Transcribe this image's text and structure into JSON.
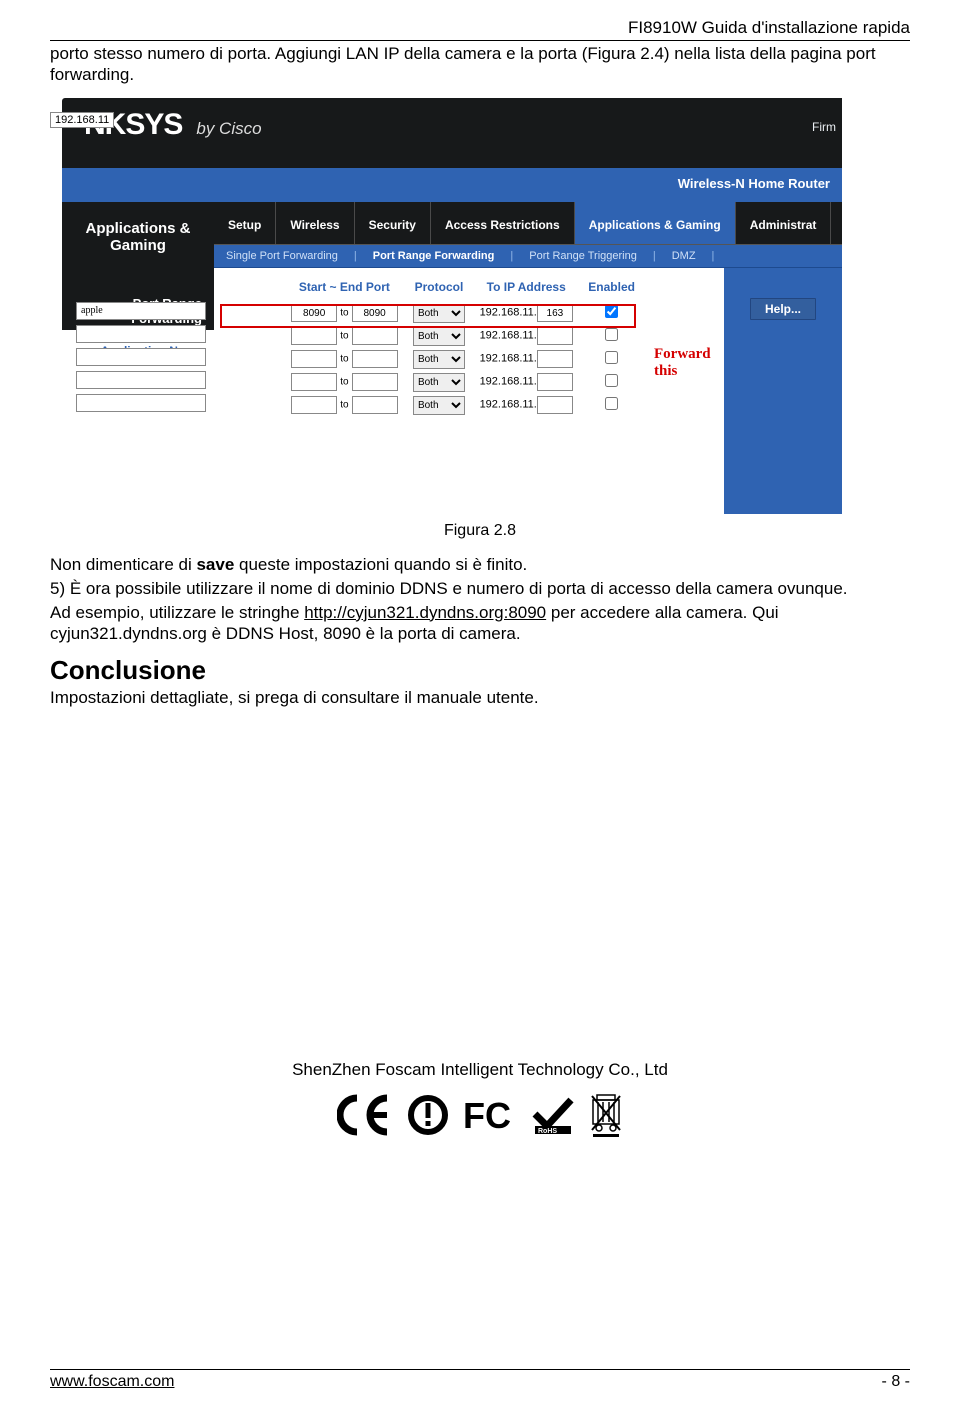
{
  "header_title": "FI8910W Guida d'installazione rapida",
  "intro": "porto stesso numero di porta. Aggiungi LAN IP della camera e la porta (Figura 2.4) nella lista della pagina port forwarding.",
  "router": {
    "ip_hint": "192.168.11",
    "brand_logo": "NKSYS",
    "brand_by": "by Cisco",
    "fir_label": "Firm",
    "bluebar_right": "",
    "bluebar_model": "Wireless-N Home Router",
    "side_section": "Applications & Gaming",
    "side_subsection": "Port Range Forwarding",
    "side_applabel": "Application Name",
    "tabs": [
      "Setup",
      "Wireless",
      "Security",
      "Access Restrictions",
      "Applications & Gaming",
      "Administrat"
    ],
    "active_tab": 4,
    "subtabs": [
      "Single Port Forwarding",
      "Port Range Forwarding",
      "Port Range Triggering",
      "DMZ"
    ],
    "active_subtab": 1,
    "help_label": "Help...",
    "table": {
      "headers": [
        "Start ~ End Port",
        "Protocol",
        "To IP Address",
        "Enabled"
      ],
      "rows": [
        {
          "app": "apple",
          "start": "8090",
          "end": "8090",
          "protocol": "Both",
          "ip_prefix": "192.168.11.",
          "ip_suffix": "163",
          "enabled": true
        },
        {
          "app": "",
          "start": "",
          "end": "",
          "protocol": "Both",
          "ip_prefix": "192.168.11.",
          "ip_suffix": "",
          "enabled": false
        },
        {
          "app": "",
          "start": "",
          "end": "",
          "protocol": "Both",
          "ip_prefix": "192.168.11.",
          "ip_suffix": "",
          "enabled": false
        },
        {
          "app": "",
          "start": "",
          "end": "",
          "protocol": "Both",
          "ip_prefix": "192.168.11.",
          "ip_suffix": "",
          "enabled": false
        },
        {
          "app": "",
          "start": "",
          "end": "",
          "protocol": "Both",
          "ip_prefix": "192.168.11.",
          "ip_suffix": "",
          "enabled": false
        }
      ]
    },
    "forward_label": "Forward this"
  },
  "figure_caption": "Figura 2.8",
  "p1_a": "Non dimenticare di ",
  "p1_b": "save",
  "p1_c": " queste impostazioni quando si è finito.",
  "p2": "5) È ora possibile utilizzare il nome di dominio DDNS e numero di porta di accesso della camera ovunque.",
  "p3_a": "Ad esempio, utilizzare le stringhe ",
  "p3_link": "http://cyjun321.dyndns.org:8090",
  "p3_b": " per accedere alla camera. Qui cyjun321.dyndns.org è DDNS Host, 8090 è la porta di camera.",
  "conclusion_h": "Conclusione",
  "conclusion_p": "Impostazioni dettagliate, si prega di consultare il manuale utente.",
  "company": "ShenZhen Foscam Intelligent Technology Co., Ltd",
  "footer_url": "www.foscam.com",
  "footer_page": "- 8 -"
}
